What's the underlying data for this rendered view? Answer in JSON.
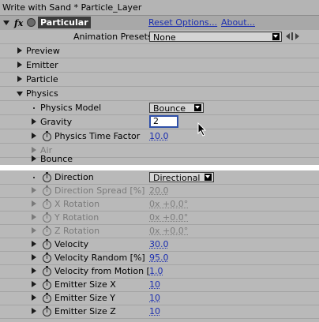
{
  "title_bar": {
    "text": "Write with Sand * Particle_Layer"
  },
  "effect": {
    "fx": "fx",
    "name": "Particular",
    "reset": "Reset Options...",
    "about": "About..."
  },
  "presets": {
    "label": "Animation Presets:",
    "value": "None"
  },
  "groups": {
    "preview": "Preview",
    "emitter": "Emitter",
    "particle": "Particle",
    "physics": "Physics"
  },
  "physics": {
    "model_label": "Physics Model",
    "model_value": "Bounce",
    "gravity_label": "Gravity",
    "gravity_value": "2",
    "time_factor_label": "Physics Time Factor",
    "time_factor_value": "10.0",
    "air_label": "Air",
    "bounce_label": "Bounce"
  },
  "emitter_params": {
    "direction_label": "Direction",
    "direction_value": "Directional",
    "spread_label": "Direction Spread [%]",
    "spread_value": "20.0",
    "xrot_label": "X Rotation",
    "xrot_value": "0x +0.0°",
    "yrot_label": "Y Rotation",
    "yrot_value": "0x +0.0°",
    "zrot_label": "Z Rotation",
    "zrot_value": "0x +0.0°",
    "velocity_label": "Velocity",
    "velocity_value": "30.0",
    "vel_random_label": "Velocity Random [%]",
    "vel_random_value": "95.0",
    "vel_motion_label": "Velocity from Motion [",
    "vel_motion_value": "1.0",
    "size_x_label": "Emitter Size X",
    "size_x_value": "10",
    "size_y_label": "Emitter Size Y",
    "size_y_value": "10",
    "size_z_label": "Emitter Size Z",
    "size_z_value": "10"
  },
  "colors": {
    "link": "#1c2fb0",
    "panel": "#b9b9b9",
    "header": "#a6a6a6",
    "dim": "#7d7d7d"
  }
}
